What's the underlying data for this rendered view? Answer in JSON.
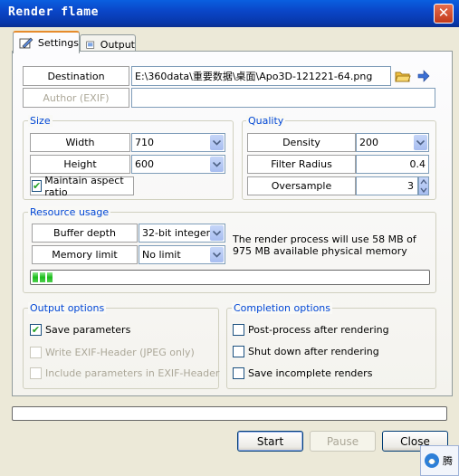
{
  "window": {
    "title": "Render flame",
    "close_glyph": "✕"
  },
  "tabs": [
    {
      "label": "Settings"
    },
    {
      "label": "Output"
    }
  ],
  "destination": {
    "label": "Destination",
    "value": "E:\\360data\\重要数据\\桌面\\Apo3D-121221-64.png"
  },
  "author": {
    "label": "Author (EXIF)",
    "value": ""
  },
  "size": {
    "title": "Size",
    "width_label": "Width",
    "width_value": "710",
    "height_label": "Height",
    "height_value": "600",
    "maintain_label": "Maintain aspect ratio",
    "maintain_checked": true
  },
  "quality": {
    "title": "Quality",
    "density_label": "Density",
    "density_value": "200",
    "filter_label": "Filter Radius",
    "filter_value": "0.4",
    "oversample_label": "Oversample",
    "oversample_value": "3"
  },
  "resource": {
    "title": "Resource usage",
    "buffer_label": "Buffer depth",
    "buffer_value": "32-bit integer",
    "memory_label": "Memory limit",
    "memory_value": "No limit",
    "info": "The render process will use 58 MB of 975 MB available physical memory",
    "usage_fraction": 0.06
  },
  "output_options": {
    "title": "Output options",
    "items": [
      {
        "label": "Save parameters",
        "checked": true,
        "enabled": true
      },
      {
        "label": "Write EXIF-Header (JPEG only)",
        "checked": false,
        "enabled": false
      },
      {
        "label": "Include parameters in EXIF-Header",
        "checked": false,
        "enabled": false
      }
    ]
  },
  "completion_options": {
    "title": "Completion options",
    "items": [
      {
        "label": "Post-process after rendering",
        "checked": false
      },
      {
        "label": "Shut down after rendering",
        "checked": false
      },
      {
        "label": "Save incomplete renders",
        "checked": false
      }
    ]
  },
  "render_progress": 0,
  "buttons": {
    "start": "Start",
    "pause": "Pause",
    "close": "Close"
  },
  "taskbar": {
    "text": "腾"
  },
  "colors": {
    "title_bar": "#0a46c8",
    "progress_green": "#1bbd1b",
    "group_title": "#0046d5"
  }
}
